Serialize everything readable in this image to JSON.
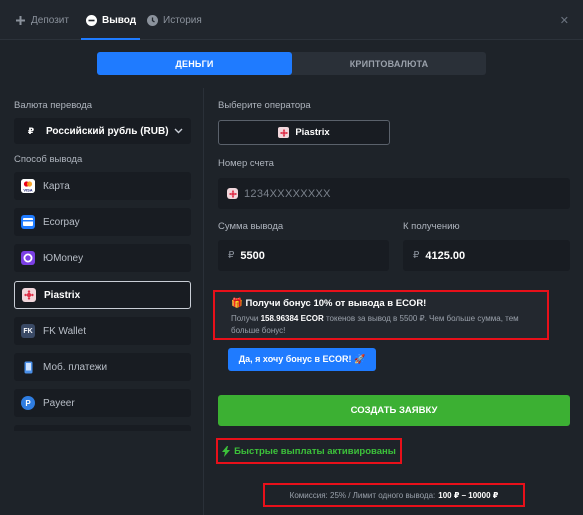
{
  "tabs": [
    {
      "label": "Депозит",
      "icon": "plus-icon"
    },
    {
      "label": "Вывод",
      "icon": "minus-circle-icon",
      "active": true
    },
    {
      "label": "История",
      "icon": "clock-icon"
    }
  ],
  "segment": {
    "money": "ДЕНЬГИ",
    "crypto": "КРИПТОВАЛЮТА",
    "active": "money"
  },
  "left": {
    "currency_label": "Валюта перевода",
    "currency_value": "Российский рубль (RUB)",
    "currency_icon": "₽",
    "method_label": "Способ вывода",
    "methods": [
      {
        "label": "Карта",
        "icon": "visa-card-icon"
      },
      {
        "label": "Ecorpay",
        "icon": "ecorpay-icon"
      },
      {
        "label": "ЮMoney",
        "icon": "yoomoney-icon"
      },
      {
        "label": "Piastrix",
        "icon": "piastrix-icon",
        "selected": true
      },
      {
        "label": "FK Wallet",
        "icon": "fk-wallet-icon"
      },
      {
        "label": "Моб. платежи",
        "icon": "phone-icon"
      },
      {
        "label": "Payeer",
        "icon": "payeer-icon"
      }
    ]
  },
  "right": {
    "operator_label": "Выберите оператора",
    "operator_value": "Piastrix",
    "account_label": "Номер счета",
    "account_placeholder": "1234XXXXXXXX",
    "amount_label": "Сумма вывода",
    "amount_currency": "₽",
    "amount_value": "5500",
    "receive_label": "К получению",
    "receive_currency": "₽",
    "receive_value": "4125.00"
  },
  "bonus": {
    "icon": "🎁",
    "title": "Получи бонус 10% от вывода в ECOR!",
    "text_prefix": "Получи",
    "text_amount": "158.96384 ECOR",
    "text_suffix": "токенов за вывод в 5500 ₽. Чем больше сумма, тем больше бонус!",
    "button": "Да, я хочу бонус в ECOR! 🚀"
  },
  "create_button": "СОЗДАТЬ ЗАЯВКУ",
  "fast_payouts": "Быстрые выплаты активированы",
  "limits": {
    "prefix": "Комиссия: 25% / Лимит одного вывода:",
    "value": "100 ₽ – 10000 ₽"
  },
  "colors": {
    "accent": "#1f7bff",
    "success": "#3cb033",
    "highlight": "#e8101a",
    "background": "#1e2329"
  }
}
